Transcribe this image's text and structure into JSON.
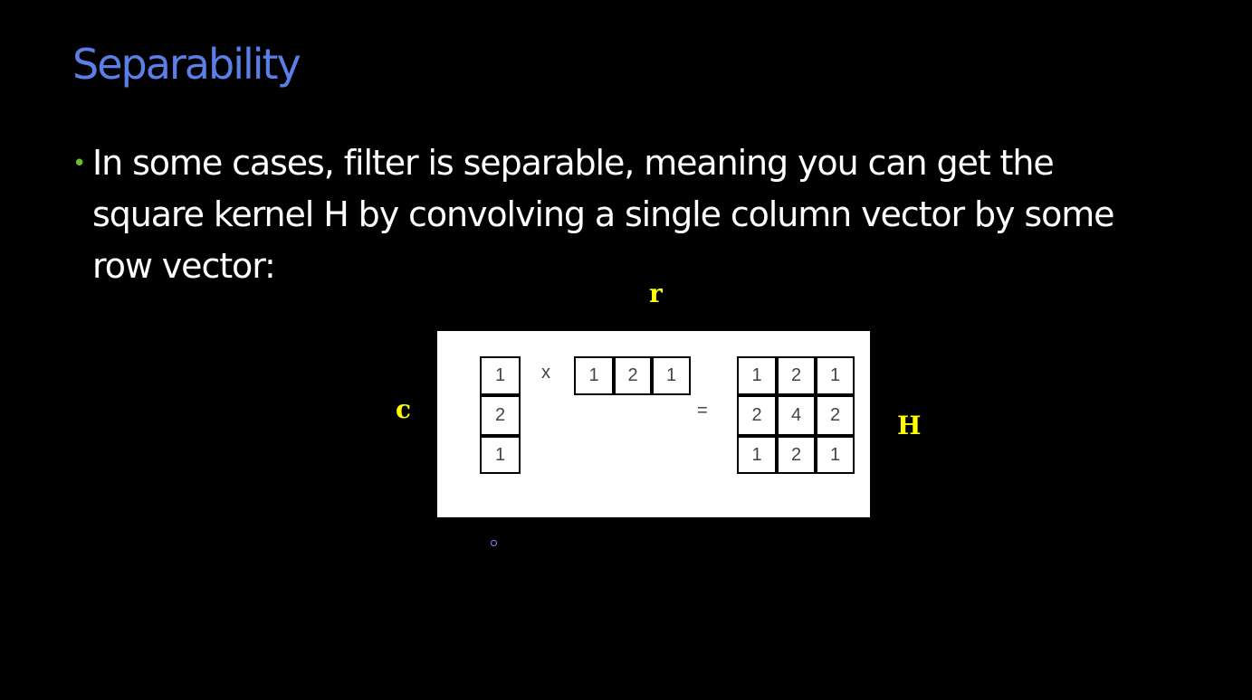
{
  "slide": {
    "title": "Separability",
    "bullet": {
      "line1": "In some cases, filter is separable, meaning you can get the",
      "line2": "square kernel H by convolving a single column vector by some",
      "line3": "row vector:"
    }
  },
  "figure": {
    "labels": {
      "c": "c",
      "r": "r",
      "H": "H"
    },
    "column_vector": [
      "1",
      "2",
      "1"
    ],
    "row_vector": [
      "1",
      "2",
      "1"
    ],
    "times_symbol": "x",
    "equals_symbol": "=",
    "kernel": [
      [
        "1",
        "2",
        "1"
      ],
      [
        "2",
        "4",
        "2"
      ],
      [
        "1",
        "2",
        "1"
      ]
    ]
  },
  "colors": {
    "title": "#5b7fe6",
    "bullet_dot": "#6bbf2a",
    "variable_labels": "#ffff00",
    "background": "#000000"
  }
}
